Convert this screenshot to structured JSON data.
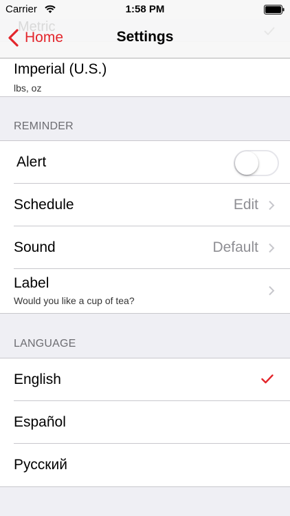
{
  "status_bar": {
    "carrier": "Carrier",
    "time": "1:58 PM"
  },
  "nav": {
    "back_label": "Home",
    "title": "Settings",
    "ghost_label": "Metric",
    "accent_color": "#e3252b"
  },
  "units": {
    "option": {
      "title": "Imperial (U.S.)",
      "subtitle": "lbs, oz"
    }
  },
  "reminder": {
    "header": "REMINDER",
    "alert": {
      "label": "Alert",
      "toggle_on": false
    },
    "schedule": {
      "label": "Schedule",
      "value": "Edit"
    },
    "sound": {
      "label": "Sound",
      "value": "Default"
    },
    "label_row": {
      "label": "Label",
      "subtitle": "Would you like a cup of tea?"
    }
  },
  "language": {
    "header": "LANGUAGE",
    "items": [
      {
        "label": "English",
        "selected": true
      },
      {
        "label": "Español",
        "selected": false
      },
      {
        "label": "Русский",
        "selected": false
      }
    ]
  }
}
